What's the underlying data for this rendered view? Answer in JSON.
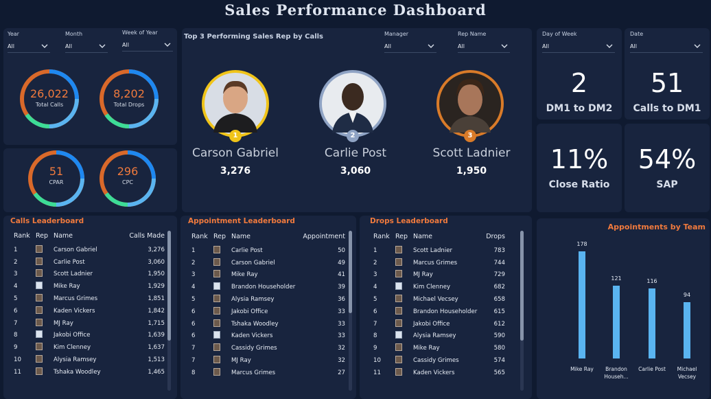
{
  "dashboard": {
    "title": "Sales Performance Dashboard"
  },
  "filters": {
    "year": {
      "label": "Year",
      "value": "All"
    },
    "month": {
      "label": "Month",
      "value": "All"
    },
    "week": {
      "label": "Week of Year",
      "value": "All"
    },
    "manager": {
      "label": "Manager",
      "value": "All"
    },
    "rep_name": {
      "label": "Rep Name",
      "value": "All"
    },
    "day_of_week": {
      "label": "Day of Week",
      "value": "All"
    },
    "date": {
      "label": "Date",
      "value": "All"
    }
  },
  "rings": {
    "total_calls": {
      "value": "26,022",
      "label": "Total Calls"
    },
    "total_drops": {
      "value": "8,202",
      "label": "Total Drops"
    },
    "cpar": {
      "value": "51",
      "label": "CPAR"
    },
    "cpc": {
      "value": "296",
      "label": "CPC"
    }
  },
  "colors": {
    "accent": "#f07a3d",
    "ring_blue": "#1e88f0",
    "ring_green": "#3ddc97",
    "ring_orange": "#d9692a",
    "bar": "#5ab4f0",
    "gold": "#f0c419",
    "silver": "#8fa3c4",
    "bronze": "#d97b29"
  },
  "top3": {
    "title": "Top 3 Performing Sales Rep by Calls",
    "reps": [
      {
        "rank": "1",
        "name": "Carson Gabriel",
        "calls": "3,276"
      },
      {
        "rank": "2",
        "name": "Carlie Post",
        "calls": "3,060"
      },
      {
        "rank": "3",
        "name": "Scott Ladnier",
        "calls": "1,950"
      }
    ]
  },
  "kpis": {
    "dm1_dm2": {
      "value": "2",
      "label": "DM1 to DM2"
    },
    "calls_dm1": {
      "value": "51",
      "label": "Calls to DM1"
    },
    "close_ratio": {
      "value": "11%",
      "label": "Close Ratio"
    },
    "sap": {
      "value": "54%",
      "label": "SAP"
    }
  },
  "calls_leaderboard": {
    "title": "Calls Leaderboard",
    "headers": [
      "Rank",
      "Rep",
      "Name",
      "Calls Made"
    ],
    "rows": [
      [
        "1",
        "Carson Gabriel",
        "3,276"
      ],
      [
        "2",
        "Carlie Post",
        "3,060"
      ],
      [
        "3",
        "Scott Ladnier",
        "1,950"
      ],
      [
        "4",
        "Mike Ray",
        "1,929"
      ],
      [
        "5",
        "Marcus Grimes",
        "1,851"
      ],
      [
        "6",
        "Kaden Vickers",
        "1,842"
      ],
      [
        "7",
        "MJ Ray",
        "1,715"
      ],
      [
        "8",
        "Jakobi Office",
        "1,639"
      ],
      [
        "9",
        "Kim Clenney",
        "1,637"
      ],
      [
        "10",
        "Alysia Ramsey",
        "1,513"
      ],
      [
        "11",
        "Tshaka Woodley",
        "1,465"
      ]
    ]
  },
  "appointment_leaderboard": {
    "title": "Appointment Leaderboard",
    "headers": [
      "Rank",
      "Rep",
      "Name",
      "Appointment"
    ],
    "rows": [
      [
        "1",
        "Carlie Post",
        "50"
      ],
      [
        "2",
        "Carson Gabriel",
        "49"
      ],
      [
        "3",
        "Mike Ray",
        "41"
      ],
      [
        "4",
        "Brandon Householder",
        "39"
      ],
      [
        "5",
        "Alysia Ramsey",
        "36"
      ],
      [
        "6",
        "Jakobi Office",
        "33"
      ],
      [
        "6",
        "Tshaka Woodley",
        "33"
      ],
      [
        "6",
        "Kaden Vickers",
        "33"
      ],
      [
        "7",
        "Cassidy Grimes",
        "32"
      ],
      [
        "7",
        "MJ Ray",
        "32"
      ],
      [
        "8",
        "Marcus Grimes",
        "27"
      ]
    ]
  },
  "drops_leaderboard": {
    "title": "Drops Leaderboard",
    "headers": [
      "Rank",
      "Rep",
      "Name",
      "Drops"
    ],
    "rows": [
      [
        "1",
        "Scott Ladnier",
        "783"
      ],
      [
        "2",
        "Marcus Grimes",
        "744"
      ],
      [
        "3",
        "MJ Ray",
        "729"
      ],
      [
        "4",
        "Kim Clenney",
        "682"
      ],
      [
        "5",
        "Michael Vecsey",
        "658"
      ],
      [
        "6",
        "Brandon Householder",
        "615"
      ],
      [
        "7",
        "Jakobi Office",
        "612"
      ],
      [
        "8",
        "Alysia Ramsey",
        "590"
      ],
      [
        "9",
        "Mike Ray",
        "580"
      ],
      [
        "10",
        "Cassidy Grimes",
        "574"
      ],
      [
        "11",
        "Kaden Vickers",
        "565"
      ]
    ]
  },
  "chart_data": {
    "type": "bar",
    "title": "Appointments by Team",
    "categories": [
      "Mike Ray",
      "Brandon Househ...",
      "Carlie Post",
      "Michael Vecsey"
    ],
    "values": [
      178,
      121,
      116,
      94
    ],
    "ylim": [
      0,
      178
    ]
  }
}
